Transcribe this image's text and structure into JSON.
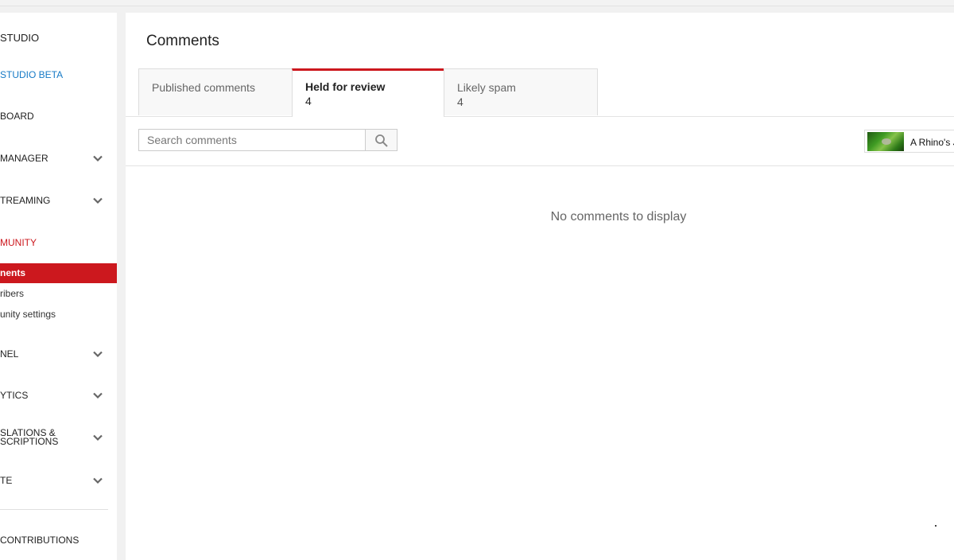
{
  "sidebar": {
    "studio_title": "STUDIO",
    "studio_beta": "STUDIO BETA",
    "dashboard": "BOARD",
    "video_manager": " MANAGER",
    "live_streaming": "TREAMING",
    "community": "MUNITY",
    "community_items": [
      "nents",
      "ribers",
      "unity settings"
    ],
    "channel": "NEL",
    "analytics": "YTICS",
    "translations_line1": "SLATIONS &",
    "translations_line2": "SCRIPTIONS",
    "create": "TE",
    "contributions": "CONTRIBUTIONS"
  },
  "page": {
    "title": "Comments",
    "tabs": [
      {
        "label": "Published comments",
        "count": ""
      },
      {
        "label": "Held for review",
        "count": "4"
      },
      {
        "label": "Likely spam",
        "count": "4"
      }
    ],
    "active_tab": "Held for review",
    "search": {
      "placeholder": "Search comments",
      "value": "",
      "button_icon": "search-icon"
    },
    "video_filter": {
      "title": "A Rhino's J"
    },
    "empty_message": "No comments to display"
  },
  "colors": {
    "accent": "#cc181e",
    "link": "#167ac6"
  }
}
